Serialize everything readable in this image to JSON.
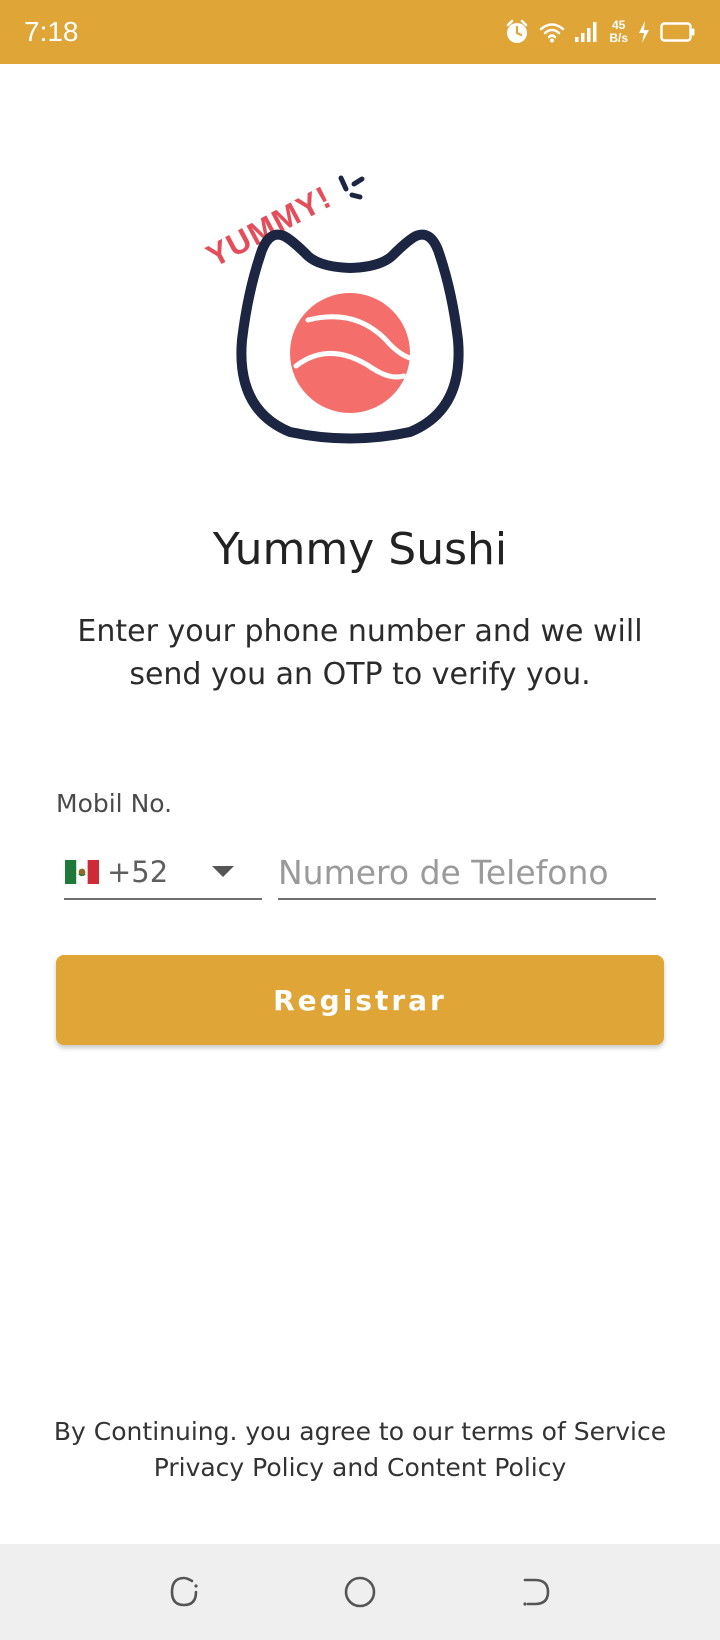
{
  "status_bar": {
    "time": "7:18",
    "net_speed_value": "45",
    "net_speed_unit": "B/s",
    "icons": [
      "alarm-icon",
      "wifi-icon",
      "signal-icon",
      "charging-icon",
      "battery-icon"
    ],
    "background_color": "#dfa537"
  },
  "logo": {
    "badge_text": "YUMMY!",
    "accent_color": "#f46f6b",
    "outline_color": "#1c2541"
  },
  "header": {
    "title": "Yummy Sushi",
    "subtitle": "Enter your phone number and we will send you an OTP to verify you."
  },
  "form": {
    "mobile_label": "Mobil No.",
    "country": {
      "flag_icon": "mexico-flag-icon",
      "code": "+52"
    },
    "phone_value": "",
    "phone_placeholder": "Numero de Telefono",
    "submit_label": "Registrar"
  },
  "footer": {
    "terms_line1": "By Continuing. you agree to our terms of Service",
    "terms_line2": "Privacy Policy and Content Policy"
  },
  "nav_bar": {
    "icons": [
      "recents-icon",
      "home-icon",
      "back-icon"
    ]
  },
  "colors": {
    "primary": "#dfa537",
    "text": "#222222"
  }
}
